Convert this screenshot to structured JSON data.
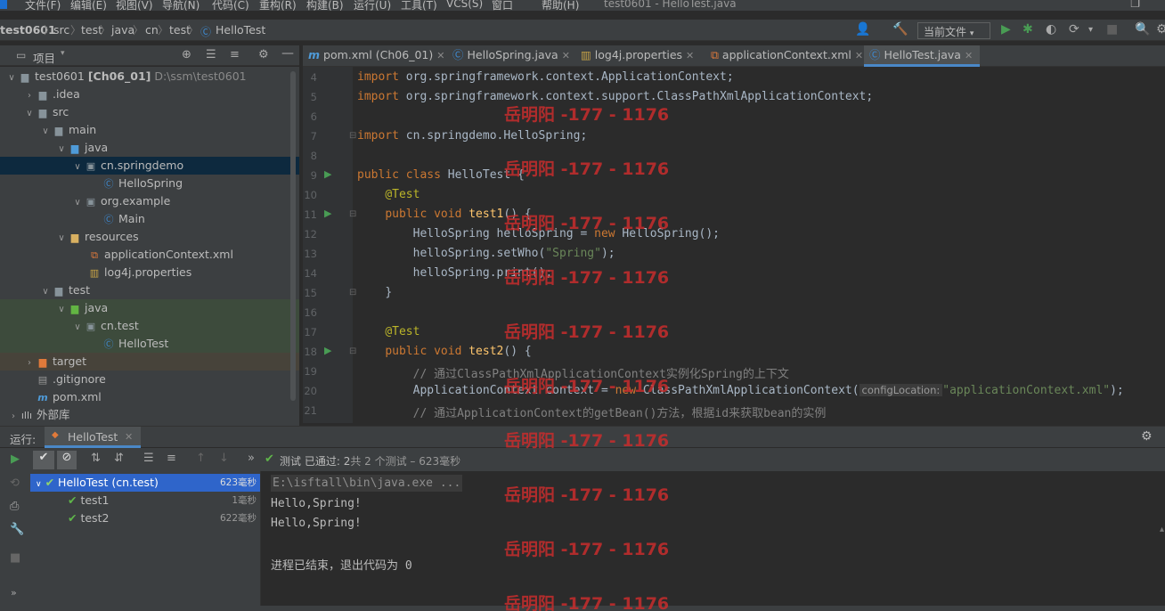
{
  "menu": {
    "items": [
      "文件(F)",
      "编辑(E)",
      "视图(V)",
      "导航(N)",
      "代码(C)",
      "重构(R)",
      "构建(B)",
      "运行(U)",
      "工具(T)",
      "VCS(S)",
      "窗口",
      "帮助(H)"
    ],
    "window_title": "test0601 - HelloTest.java"
  },
  "breadcrumb": [
    "test0601",
    "src",
    "test",
    "java",
    "cn",
    "test",
    "HelloTest"
  ],
  "toolbar": {
    "run_config": "当前文件"
  },
  "project": {
    "panel_title": "项目",
    "tree": [
      {
        "label": "test0601",
        "extra": "[Ch06_01]",
        "path": "D:\\ssm\\test0601"
      },
      {
        "label": ".idea"
      },
      {
        "label": "src"
      },
      {
        "label": "main"
      },
      {
        "label": "java"
      },
      {
        "label": "cn.springdemo"
      },
      {
        "label": "HelloSpring"
      },
      {
        "label": "org.example"
      },
      {
        "label": "Main"
      },
      {
        "label": "resources"
      },
      {
        "label": "applicationContext.xml"
      },
      {
        "label": "log4j.properties"
      },
      {
        "label": "test"
      },
      {
        "label": "java"
      },
      {
        "label": "cn.test"
      },
      {
        "label": "HelloTest"
      },
      {
        "label": "target"
      },
      {
        "label": ".gitignore"
      },
      {
        "label": "pom.xml"
      },
      {
        "label": "外部库"
      }
    ]
  },
  "editor": {
    "tabs": [
      {
        "label": "pom.xml (Ch06_01)"
      },
      {
        "label": "HelloSpring.java"
      },
      {
        "label": "log4j.properties"
      },
      {
        "label": "applicationContext.xml"
      },
      {
        "label": "HelloTest.java"
      }
    ],
    "line_numbers": [
      "4",
      "5",
      "6",
      "7",
      "8",
      "9",
      "10",
      "11",
      "12",
      "13",
      "14",
      "15",
      "16",
      "17",
      "18",
      "19",
      "20",
      "21"
    ],
    "code": {
      "l4_kw": "import",
      "l4_rest": " org.springframework.context.ApplicationContext;",
      "l5_kw": "import",
      "l5_rest": " org.springframework.context.support.ClassPathXmlApplicationContext;",
      "l7_kw": "import",
      "l7_rest": " cn.springdemo.HelloSpring;",
      "l9_kw": "public class",
      "l9_rest": " HelloTest {",
      "l10_ann": "@Test",
      "l11_kw": "public void",
      "l11_fn": "test1",
      "l11_rest": "() {",
      "l12_a": "HelloSpring helloSpring = ",
      "l12_kw": "new",
      "l12_b": " HelloSpring();",
      "l13_a": "helloSpring.setWho(",
      "l13_str": "\"Spring\"",
      "l13_b": ");",
      "l14": "helloSpring.print();",
      "l15": "}",
      "l17_ann": "@Test",
      "l18_kw": "public void",
      "l18_fn": "test2",
      "l18_rest": "() {",
      "l19": "// 通过ClassPathXmlApplicationContext实例化Spring的上下文",
      "l20_a": "ApplicationContext context = ",
      "l20_kw": "new",
      "l20_b": " ClassPathXmlApplicationContext(",
      "l20_hint": "configLocation:",
      "l20_str": "\"applicationContext.xml\"",
      "l20_c": ");",
      "l21": "// 通过ApplicationContext的getBean()方法，根据id来获取bean的实例"
    }
  },
  "run": {
    "label": "运行:",
    "tab": "HelloTest",
    "status_prefix": "测试 已通过:",
    "status_count": "2",
    "status_suffix": "共 2 个测试 – 623毫秒",
    "tests": [
      {
        "name": "HelloTest (cn.test)",
        "time": "623毫秒"
      },
      {
        "name": "test1",
        "time": "1毫秒"
      },
      {
        "name": "test2",
        "time": "622毫秒"
      }
    ],
    "console": [
      "E:\\isftall\\bin\\java.exe ...",
      "Hello,Spring!",
      "Hello,Spring!",
      "进程已结束，退出代码为 0"
    ]
  },
  "watermark": "岳明阳 -177 - 1176",
  "colors": {
    "bg": "#2b2b2b",
    "panel": "#3c3f41",
    "keyword": "#cc7832",
    "annotation": "#bbb529",
    "string": "#6a8759",
    "comment": "#808080",
    "selection": "#2f65ca",
    "pass": "#5fb54a",
    "watermark": "#c82d2d"
  }
}
